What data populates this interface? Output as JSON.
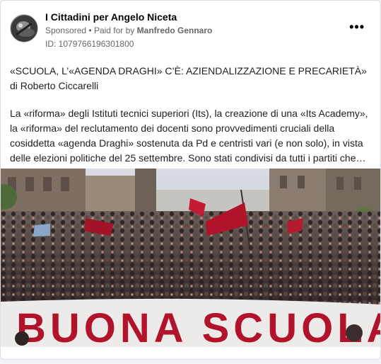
{
  "post": {
    "page_name": "I Cittadini per Angelo Niceta",
    "sponsored": "Sponsored",
    "separator": "•",
    "paid_for_by": "Paid for by",
    "payer": "Manfredo Gennaro",
    "ad_id": "ID: 1079766196301800",
    "more_icon": "•••",
    "headline": "«SCUOLA, L’«AGENDA DRAGHI» C’È: AZIENDALIZZAZIONE E PRECARIETÀ» di Roberto Ciccarelli",
    "body": "La «riforma» degli Istituti tecnici superiori (Its), la creazione di una «Its Academy», la «riforma» del reclutamento dei docenti sono provvedimenti cruciali della cosiddetta «agenda Draghi» sostenuta da Pd e centristi vari (e non solo), in vista delle elezioni politiche del 25 settembre. Sono stati condivisi da tutti i partiti che…",
    "banner_text": "BUONA SCUOLA"
  },
  "colors": {
    "text_primary": "#050505",
    "text_secondary": "#65676b",
    "card_bg": "#ffffff",
    "flag_red": "#b1132b"
  }
}
